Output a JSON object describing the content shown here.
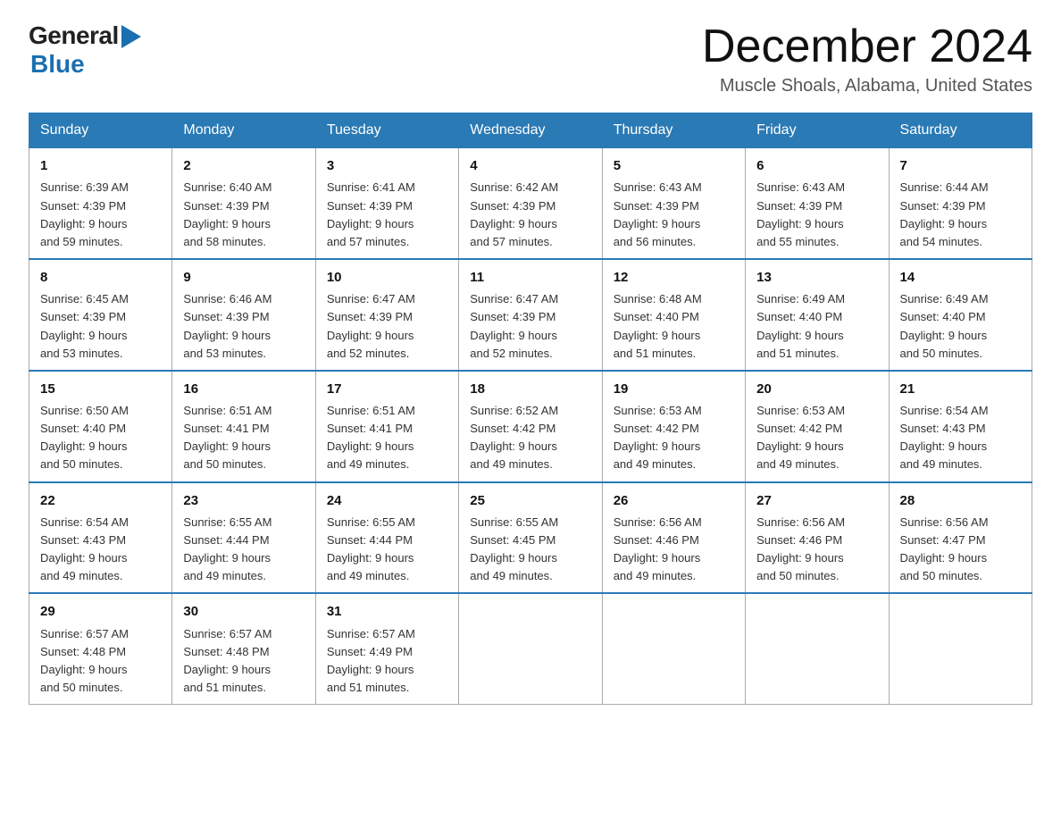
{
  "logo": {
    "text_general": "General",
    "logo_triangle": "▶",
    "text_blue": "Blue"
  },
  "title": {
    "month_year": "December 2024",
    "location": "Muscle Shoals, Alabama, United States"
  },
  "weekdays": [
    "Sunday",
    "Monday",
    "Tuesday",
    "Wednesday",
    "Thursday",
    "Friday",
    "Saturday"
  ],
  "weeks": [
    [
      {
        "day": "1",
        "sunrise": "6:39 AM",
        "sunset": "4:39 PM",
        "daylight": "9 hours and 59 minutes."
      },
      {
        "day": "2",
        "sunrise": "6:40 AM",
        "sunset": "4:39 PM",
        "daylight": "9 hours and 58 minutes."
      },
      {
        "day": "3",
        "sunrise": "6:41 AM",
        "sunset": "4:39 PM",
        "daylight": "9 hours and 57 minutes."
      },
      {
        "day": "4",
        "sunrise": "6:42 AM",
        "sunset": "4:39 PM",
        "daylight": "9 hours and 57 minutes."
      },
      {
        "day": "5",
        "sunrise": "6:43 AM",
        "sunset": "4:39 PM",
        "daylight": "9 hours and 56 minutes."
      },
      {
        "day": "6",
        "sunrise": "6:43 AM",
        "sunset": "4:39 PM",
        "daylight": "9 hours and 55 minutes."
      },
      {
        "day": "7",
        "sunrise": "6:44 AM",
        "sunset": "4:39 PM",
        "daylight": "9 hours and 54 minutes."
      }
    ],
    [
      {
        "day": "8",
        "sunrise": "6:45 AM",
        "sunset": "4:39 PM",
        "daylight": "9 hours and 53 minutes."
      },
      {
        "day": "9",
        "sunrise": "6:46 AM",
        "sunset": "4:39 PM",
        "daylight": "9 hours and 53 minutes."
      },
      {
        "day": "10",
        "sunrise": "6:47 AM",
        "sunset": "4:39 PM",
        "daylight": "9 hours and 52 minutes."
      },
      {
        "day": "11",
        "sunrise": "6:47 AM",
        "sunset": "4:39 PM",
        "daylight": "9 hours and 52 minutes."
      },
      {
        "day": "12",
        "sunrise": "6:48 AM",
        "sunset": "4:40 PM",
        "daylight": "9 hours and 51 minutes."
      },
      {
        "day": "13",
        "sunrise": "6:49 AM",
        "sunset": "4:40 PM",
        "daylight": "9 hours and 51 minutes."
      },
      {
        "day": "14",
        "sunrise": "6:49 AM",
        "sunset": "4:40 PM",
        "daylight": "9 hours and 50 minutes."
      }
    ],
    [
      {
        "day": "15",
        "sunrise": "6:50 AM",
        "sunset": "4:40 PM",
        "daylight": "9 hours and 50 minutes."
      },
      {
        "day": "16",
        "sunrise": "6:51 AM",
        "sunset": "4:41 PM",
        "daylight": "9 hours and 50 minutes."
      },
      {
        "day": "17",
        "sunrise": "6:51 AM",
        "sunset": "4:41 PM",
        "daylight": "9 hours and 49 minutes."
      },
      {
        "day": "18",
        "sunrise": "6:52 AM",
        "sunset": "4:42 PM",
        "daylight": "9 hours and 49 minutes."
      },
      {
        "day": "19",
        "sunrise": "6:53 AM",
        "sunset": "4:42 PM",
        "daylight": "9 hours and 49 minutes."
      },
      {
        "day": "20",
        "sunrise": "6:53 AM",
        "sunset": "4:42 PM",
        "daylight": "9 hours and 49 minutes."
      },
      {
        "day": "21",
        "sunrise": "6:54 AM",
        "sunset": "4:43 PM",
        "daylight": "9 hours and 49 minutes."
      }
    ],
    [
      {
        "day": "22",
        "sunrise": "6:54 AM",
        "sunset": "4:43 PM",
        "daylight": "9 hours and 49 minutes."
      },
      {
        "day": "23",
        "sunrise": "6:55 AM",
        "sunset": "4:44 PM",
        "daylight": "9 hours and 49 minutes."
      },
      {
        "day": "24",
        "sunrise": "6:55 AM",
        "sunset": "4:44 PM",
        "daylight": "9 hours and 49 minutes."
      },
      {
        "day": "25",
        "sunrise": "6:55 AM",
        "sunset": "4:45 PM",
        "daylight": "9 hours and 49 minutes."
      },
      {
        "day": "26",
        "sunrise": "6:56 AM",
        "sunset": "4:46 PM",
        "daylight": "9 hours and 49 minutes."
      },
      {
        "day": "27",
        "sunrise": "6:56 AM",
        "sunset": "4:46 PM",
        "daylight": "9 hours and 50 minutes."
      },
      {
        "day": "28",
        "sunrise": "6:56 AM",
        "sunset": "4:47 PM",
        "daylight": "9 hours and 50 minutes."
      }
    ],
    [
      {
        "day": "29",
        "sunrise": "6:57 AM",
        "sunset": "4:48 PM",
        "daylight": "9 hours and 50 minutes."
      },
      {
        "day": "30",
        "sunrise": "6:57 AM",
        "sunset": "4:48 PM",
        "daylight": "9 hours and 51 minutes."
      },
      {
        "day": "31",
        "sunrise": "6:57 AM",
        "sunset": "4:49 PM",
        "daylight": "9 hours and 51 minutes."
      },
      null,
      null,
      null,
      null
    ]
  ]
}
